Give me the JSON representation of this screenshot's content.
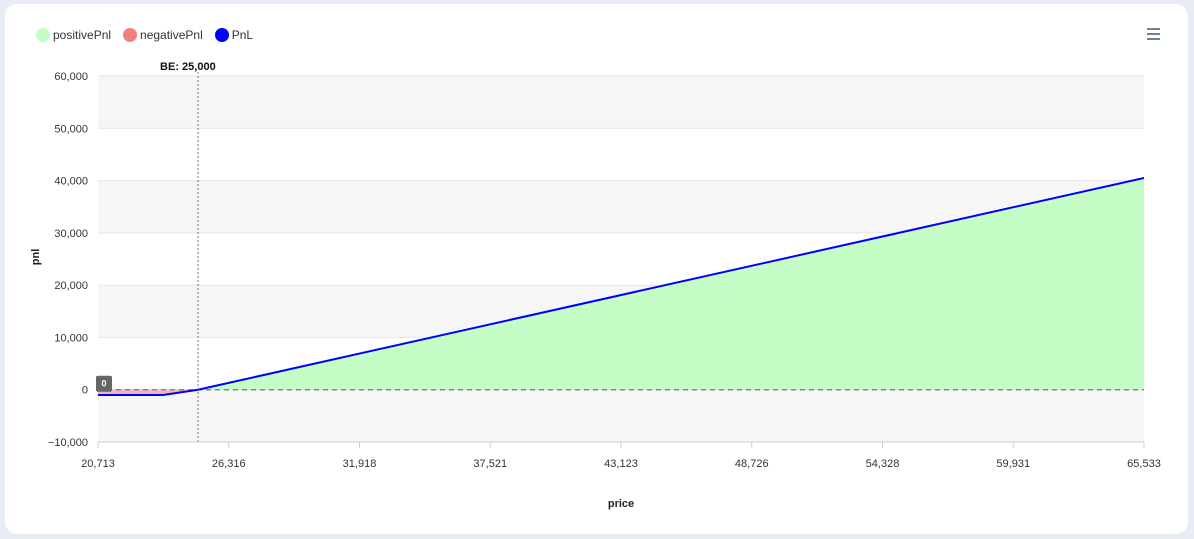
{
  "legend": [
    {
      "label": "positivePnl",
      "color": "#c6fcc6"
    },
    {
      "label": "negativePnl",
      "color": "#f08080"
    },
    {
      "label": "PnL",
      "color": "#0000ff"
    }
  ],
  "menu_icon": "hamburger-menu-icon",
  "chart_data": {
    "type": "area",
    "title": "",
    "xlabel": "price",
    "ylabel": "pnl",
    "xlim": [
      20713,
      65533
    ],
    "ylim": [
      -10000,
      60000
    ],
    "x_ticks": [
      "20,713",
      "26,316",
      "31,918",
      "37,521",
      "43,123",
      "48,726",
      "54,328",
      "59,931",
      "65,533"
    ],
    "y_ticks": [
      "60,000",
      "50,000",
      "40,000",
      "30,000",
      "20,000",
      "10,000",
      "0",
      "−10,000"
    ],
    "x_tick_values": [
      20713,
      26316,
      31918,
      37521,
      43123,
      48726,
      54328,
      59931,
      65533
    ],
    "y_tick_values": [
      60000,
      50000,
      40000,
      30000,
      20000,
      10000,
      0,
      -10000
    ],
    "grid": "alternating horizontal bands",
    "legend_position": "top-left",
    "series": [
      {
        "name": "PnL",
        "color": "#0000ff",
        "x": [
          20713,
          23500,
          25000,
          65533
        ],
        "y": [
          -1000,
          -1000,
          0,
          40500
        ]
      }
    ],
    "positive_fill": "#c6fcc6",
    "negative_fill": "#f08080",
    "annotations": {
      "breakeven_label": "BE: 25,000",
      "breakeven_x": 25000,
      "zero_badge": "0",
      "zero_line_y": 0
    }
  }
}
